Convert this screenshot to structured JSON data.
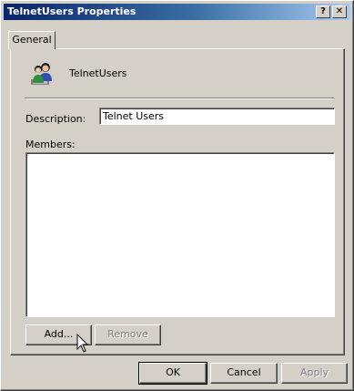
{
  "window": {
    "title": "TelnetUsers Properties",
    "help_label": "?",
    "close_label": "✕"
  },
  "tabs": [
    {
      "label": "General",
      "selected": true
    }
  ],
  "general": {
    "group_name": "TelnetUsers",
    "group_icon": "group-users-icon",
    "description_label": "Description:",
    "description_value": "Telnet Users",
    "members_label": "Members:",
    "members": []
  },
  "buttons": {
    "add": "Add...",
    "remove": "Remove",
    "ok": "OK",
    "cancel": "Cancel",
    "apply": "Apply"
  },
  "colors": {
    "title_start": "#0a246a",
    "title_end": "#a6caf0",
    "face": "#d4d0c8"
  }
}
